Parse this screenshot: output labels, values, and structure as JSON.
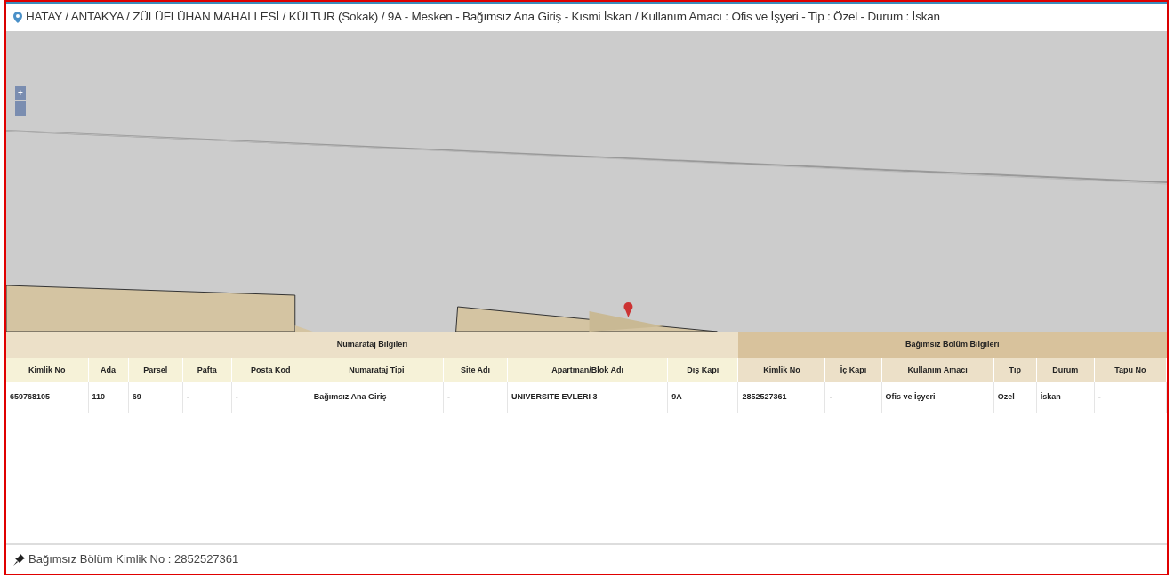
{
  "address": "HATAY / ANTAKYA / ZÜLÜFLÜHAN MAHALLESİ / KÜLTUR (Sokak) / 9A - Mesken - Bağımsız Ana Giriş - Kısmi İskan / Kullanım Amacı : Ofis ve İşyeri - Tip : Özel - Durum : İskan",
  "map": {
    "zoom_controls": [
      "+",
      "−"
    ]
  },
  "table": {
    "groups": [
      {
        "title": "Numarataj Bilgileri"
      },
      {
        "title": "Bağımsız Bolüm Bilgileri"
      }
    ],
    "columns": [
      "Kimlik No",
      "Ada",
      "Parsel",
      "Pafta",
      "Posta Kod",
      "Numarataj Tipi",
      "Site Adı",
      "Apartman/Blok Adı",
      "Dış Kapı",
      "Kimlik No",
      "İç Kapı",
      "Kullanım Amacı",
      "Tıp",
      "Durum",
      "Tapu No"
    ],
    "rows": [
      [
        "659768105",
        "110",
        "69",
        "-",
        "-",
        "Bağımsız Ana Giriş",
        "-",
        "UNIVERSITE EVLERI 3",
        "9A",
        "2852527361",
        "-",
        "Ofis ve İşyeri",
        "Ozel",
        "İskan",
        "-"
      ]
    ]
  },
  "footer": "Bağımsız Bölüm Kimlik No : 2852527361"
}
